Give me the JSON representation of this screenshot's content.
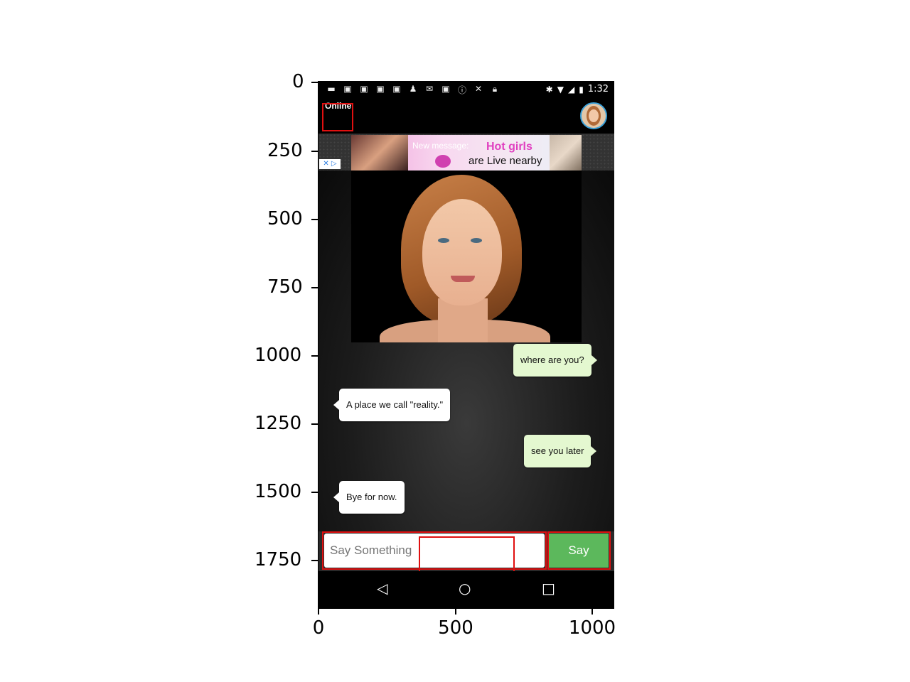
{
  "axes": {
    "y_ticks": [
      "0",
      "250",
      "500",
      "750",
      "1000",
      "1250",
      "1500",
      "1750"
    ],
    "x_ticks": [
      "0",
      "500",
      "1000"
    ]
  },
  "status_bar": {
    "time": "1:32"
  },
  "app_bar": {
    "status_label": "Online",
    "avatar_icon": "avatar-icon"
  },
  "ad": {
    "message": "New message:",
    "headline": "Hot girls",
    "subline": "are Live nearby",
    "choices_icon": "ad-choices-icon"
  },
  "messages": [
    {
      "sender": "me",
      "text": "where are you?"
    },
    {
      "sender": "them",
      "text": "A place we call \"reality.\""
    },
    {
      "sender": "me",
      "text": "see you later"
    },
    {
      "sender": "them",
      "text": "Bye for now."
    }
  ],
  "composer": {
    "placeholder": "Say Something",
    "send_label": "Say"
  },
  "nav": {
    "back": "◁",
    "home": "○",
    "recents": "□"
  },
  "colors": {
    "send_button": "#5cb85c",
    "my_bubble": "#e4f8d0",
    "their_bubble": "#ffffff",
    "highlight_box": "#e01010"
  }
}
